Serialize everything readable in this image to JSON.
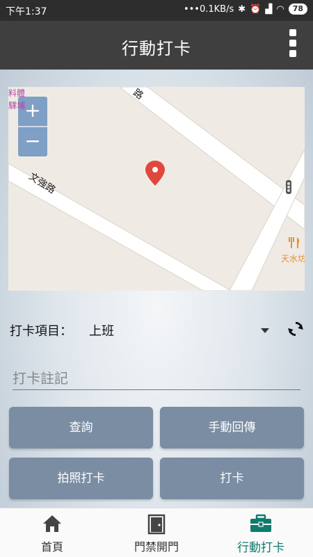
{
  "status_bar": {
    "time": "下午1:37",
    "network_speed": "•••0.1KB/s",
    "battery": "78"
  },
  "app_bar": {
    "title": "行動打卡",
    "menu_icon": "more-vert-icon"
  },
  "map": {
    "zoom_in_label": "+",
    "zoom_out_label": "−",
    "street_labels": [
      "文強路",
      "路"
    ],
    "poi_labels": [
      "天水坊",
      "料體",
      "驛埔"
    ],
    "marker_icon": "location-pin-icon",
    "marker_color": "#e0483e"
  },
  "punch": {
    "label": "打卡項目：",
    "value": "上班",
    "refresh_icon": "refresh-icon"
  },
  "note": {
    "placeholder": "打卡註記",
    "value": ""
  },
  "buttons": {
    "query": "查詢",
    "manual_upload": "手動回傳",
    "photo_punch": "拍照打卡",
    "punch": "打卡"
  },
  "bottom_nav": {
    "items": [
      {
        "label": "首頁",
        "icon": "home-icon",
        "active": false
      },
      {
        "label": "門禁開門",
        "icon": "door-icon",
        "active": false
      },
      {
        "label": "行動打卡",
        "icon": "briefcase-icon",
        "active": true
      }
    ],
    "active_color": "#0f7b6c"
  }
}
